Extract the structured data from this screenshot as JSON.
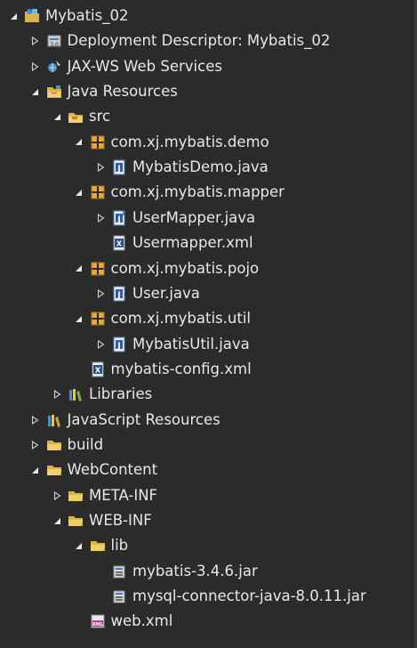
{
  "tree": [
    {
      "label": "Mybatis_02",
      "icon": "project-icon",
      "state": "expanded",
      "depth": 0
    },
    {
      "label": "Deployment Descriptor: Mybatis_02",
      "icon": "deployment-descriptor-icon",
      "state": "collapsed",
      "depth": 1
    },
    {
      "label": "JAX-WS Web Services",
      "icon": "web-services-icon",
      "state": "collapsed",
      "depth": 1
    },
    {
      "label": "Java Resources",
      "icon": "java-resources-icon",
      "state": "expanded",
      "depth": 1
    },
    {
      "label": "src",
      "icon": "source-folder-icon",
      "state": "expanded",
      "depth": 2
    },
    {
      "label": "com.xj.mybatis.demo",
      "icon": "package-icon",
      "state": "expanded",
      "depth": 3
    },
    {
      "label": "MybatisDemo.java",
      "icon": "java-file-icon",
      "state": "collapsed",
      "depth": 4
    },
    {
      "label": "com.xj.mybatis.mapper",
      "icon": "package-icon",
      "state": "expanded",
      "depth": 3
    },
    {
      "label": "UserMapper.java",
      "icon": "java-interface-file-icon",
      "state": "collapsed",
      "depth": 4
    },
    {
      "label": "Usermapper.xml",
      "icon": "xml-file-icon",
      "state": "leaf",
      "depth": 4
    },
    {
      "label": "com.xj.mybatis.pojo",
      "icon": "package-icon",
      "state": "expanded",
      "depth": 3
    },
    {
      "label": "User.java",
      "icon": "java-file-icon",
      "state": "collapsed",
      "depth": 4
    },
    {
      "label": "com.xj.mybatis.util",
      "icon": "package-icon",
      "state": "expanded",
      "depth": 3
    },
    {
      "label": "MybatisUtil.java",
      "icon": "java-file-icon",
      "state": "collapsed",
      "depth": 4
    },
    {
      "label": "mybatis-config.xml",
      "icon": "xml-file-icon",
      "state": "leaf",
      "depth": 3
    },
    {
      "label": "Libraries",
      "icon": "libraries-icon",
      "state": "collapsed",
      "depth": 2
    },
    {
      "label": "JavaScript Resources",
      "icon": "javascript-resources-icon",
      "state": "collapsed",
      "depth": 1
    },
    {
      "label": "build",
      "icon": "folder-icon",
      "state": "collapsed",
      "depth": 1
    },
    {
      "label": "WebContent",
      "icon": "folder-icon",
      "state": "expanded",
      "depth": 1
    },
    {
      "label": "META-INF",
      "icon": "folder-icon",
      "state": "collapsed",
      "depth": 2
    },
    {
      "label": "WEB-INF",
      "icon": "folder-icon",
      "state": "expanded",
      "depth": 2
    },
    {
      "label": "lib",
      "icon": "folder-icon",
      "state": "expanded",
      "depth": 3
    },
    {
      "label": "mybatis-3.4.6.jar",
      "icon": "jar-file-icon",
      "state": "leaf",
      "depth": 4
    },
    {
      "label": "mysql-connector-java-8.0.11.jar",
      "icon": "jar-file-icon",
      "state": "leaf",
      "depth": 4
    },
    {
      "label": "web.xml",
      "icon": "web-xml-file-icon",
      "state": "leaf",
      "depth": 3
    }
  ]
}
